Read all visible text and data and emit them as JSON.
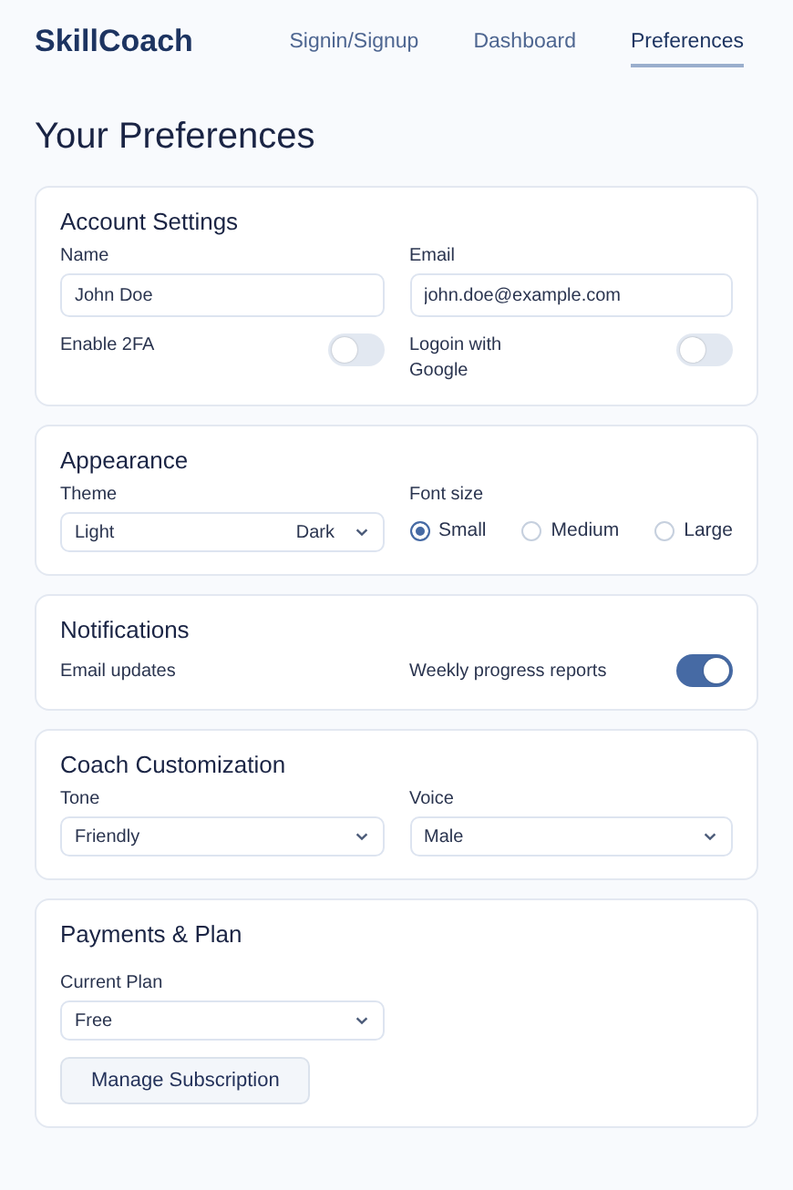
{
  "nav": {
    "brand": "SkillCoach",
    "links": [
      {
        "label": "Signin/Signup",
        "selected": false
      },
      {
        "label": "Dashboard",
        "selected": false
      },
      {
        "label": "Preferences",
        "selected": true
      }
    ]
  },
  "title": "Your Preferences",
  "account": {
    "heading": "Account Settings",
    "fields": [
      {
        "label": "Name",
        "value": "John Doe"
      },
      {
        "label": "Email",
        "value": "john.doe@example.com"
      }
    ],
    "toggles": [
      {
        "label": "Enable 2FA",
        "on": false
      },
      {
        "label": "Logoin with Google",
        "on": false
      }
    ]
  },
  "appearance": {
    "heading": "Appearance",
    "theme": {
      "label": "Theme",
      "value": "Light",
      "option": "Dark"
    },
    "font_size": {
      "label": "Font size",
      "options": [
        {
          "label": "Small",
          "selected": true
        },
        {
          "label": "Medium",
          "selected": false
        },
        {
          "label": "Large",
          "selected": false
        }
      ]
    }
  },
  "notifications": {
    "heading": "Notifications",
    "email_updates": "Email updates",
    "weekly": {
      "label": "Weekly progress reports",
      "on": true
    }
  },
  "coach": {
    "heading": "Coach Customization",
    "selects": [
      {
        "label": "Tone",
        "value": "Friendly"
      },
      {
        "label": "Voice",
        "value": "Male"
      }
    ]
  },
  "payments": {
    "heading": "Payments & Plan",
    "plan": {
      "label": "Current Plan",
      "value": "Free"
    },
    "button": "Manage Subscription"
  }
}
